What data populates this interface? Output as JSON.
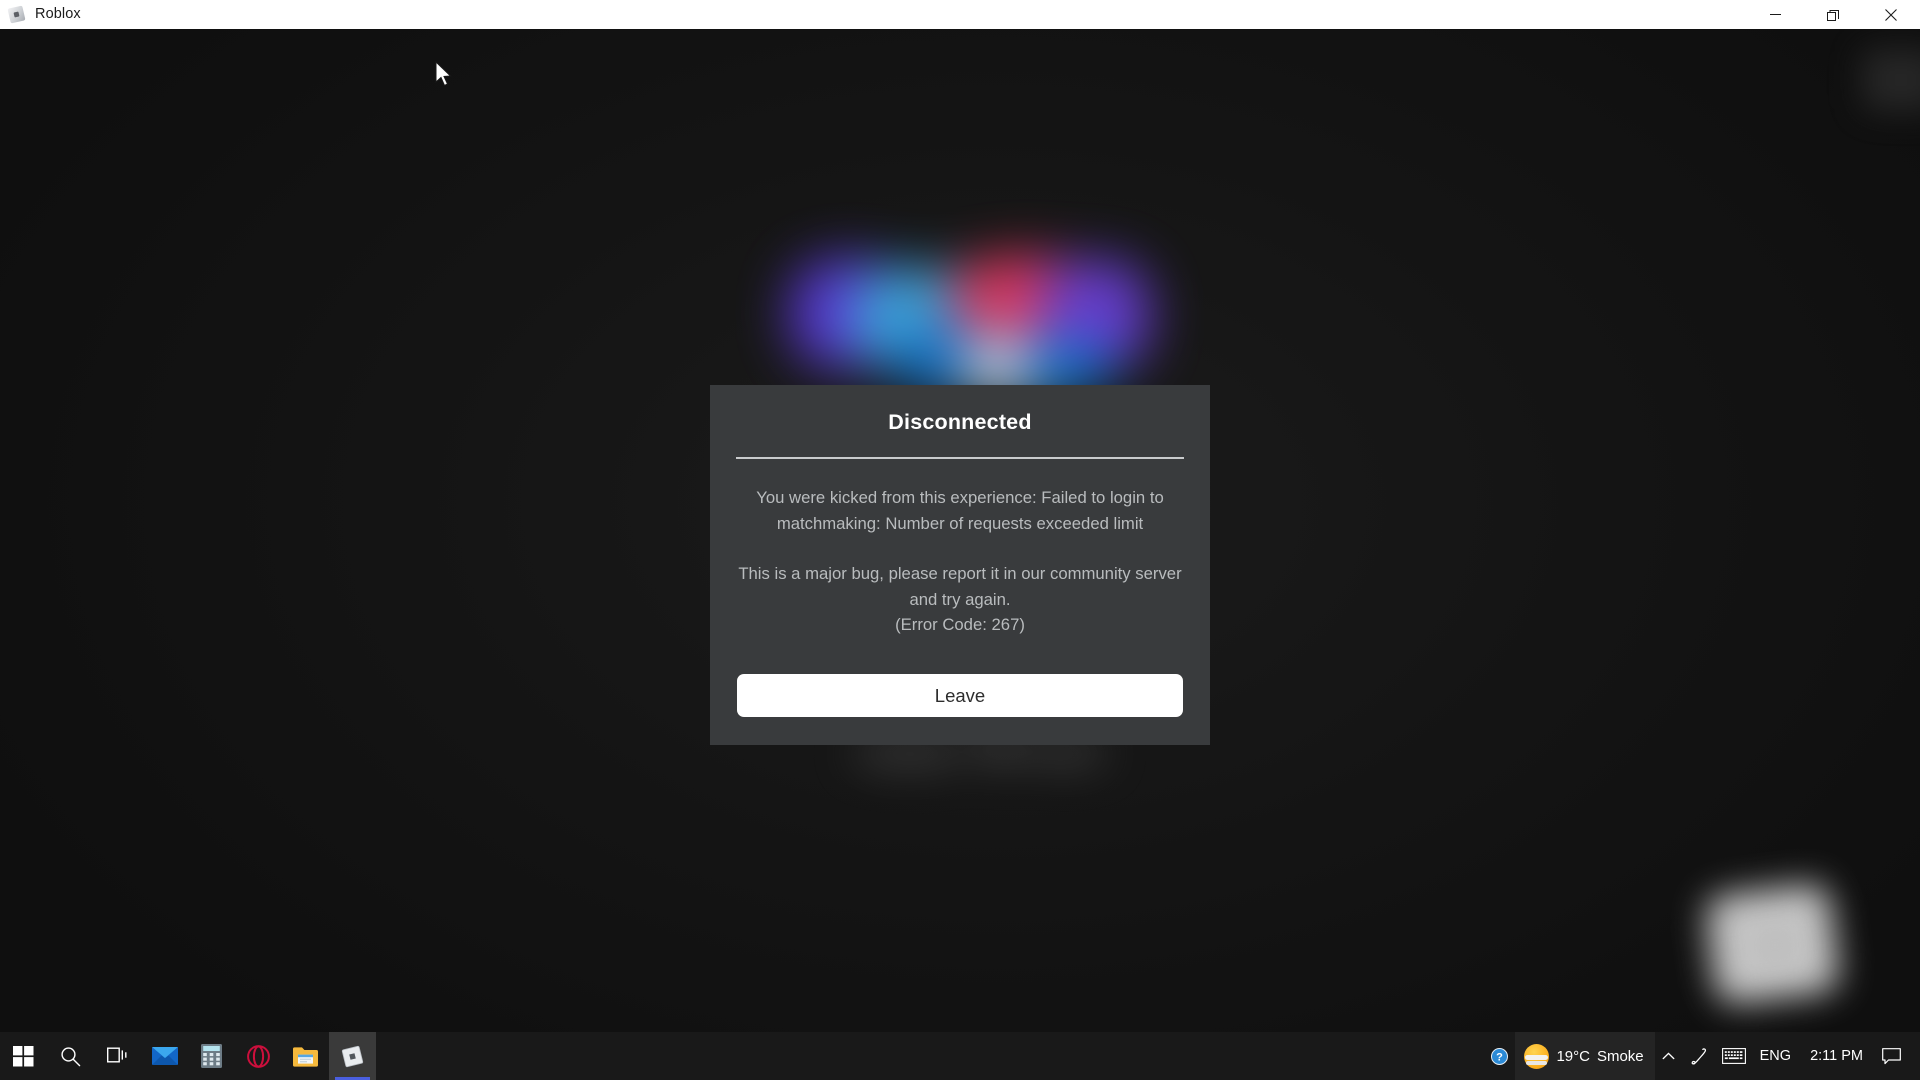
{
  "window": {
    "title": "Roblox",
    "app_icon": "roblox-icon",
    "controls": {
      "minimize": "minimize-icon",
      "restore": "restore-icon",
      "close": "close-icon"
    },
    "loading_bar_visible": true
  },
  "dialog": {
    "title": "Disconnected",
    "message_line1": "You were kicked from this experience: Failed to login to matchmaking: Number of requests exceeded limit",
    "message_line2": "This is a major bug, please report it in our community server and try again.",
    "error_code": "(Error Code: 267)",
    "button_label": "Leave",
    "background_color": "#393b3d",
    "button_color": "#ffffff",
    "title_color": "#ffffff",
    "body_color": "#b9bcbe"
  },
  "taskbar": {
    "items": [
      {
        "name": "start-button",
        "icon": "windows-logo-icon",
        "label": "Start",
        "active": false
      },
      {
        "name": "search-button",
        "icon": "search-icon",
        "label": "Search",
        "active": false
      },
      {
        "name": "task-view-button",
        "icon": "task-view-icon",
        "label": "Task View",
        "active": false
      },
      {
        "name": "mail-app",
        "icon": "mail-icon",
        "label": "Mail",
        "active": false
      },
      {
        "name": "calculator-app",
        "icon": "calculator-icon",
        "label": "Calculator",
        "active": false
      },
      {
        "name": "opera-app",
        "icon": "opera-icon",
        "label": "Opera",
        "active": false
      },
      {
        "name": "file-explorer-app",
        "icon": "folder-icon",
        "label": "File Explorer",
        "active": false
      },
      {
        "name": "roblox-app",
        "icon": "roblox-icon",
        "label": "Roblox",
        "active": true
      }
    ],
    "tray": {
      "help_icon": "help-icon",
      "weather": {
        "icon": "sun-haze-icon",
        "temperature": "19°C",
        "condition": "Smoke"
      },
      "show_hidden_icons": "chevron-up-icon",
      "pen_icon": "pen-icon",
      "keyboard_icon": "keyboard-icon",
      "language": "ENG",
      "time": "2:11 PM",
      "notifications_icon": "notification-icon"
    }
  },
  "colors": {
    "accent_blue": "#4a5fe0",
    "taskbar_bg": "#191919",
    "game_bg": "#131313",
    "titlebar_bg": "#ffffff",
    "progress_blue": "#2222dd"
  }
}
